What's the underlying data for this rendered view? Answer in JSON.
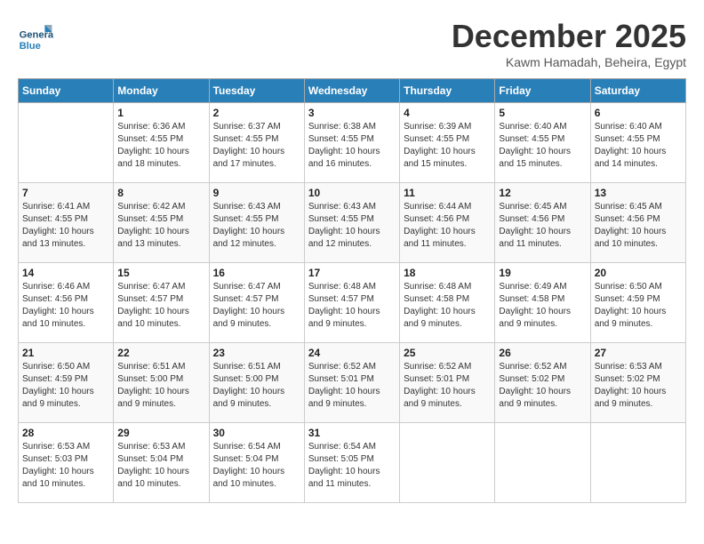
{
  "header": {
    "logo_general": "General",
    "logo_blue": "Blue",
    "month_title": "December 2025",
    "location": "Kawm Hamadah, Beheira, Egypt"
  },
  "days_of_week": [
    "Sunday",
    "Monday",
    "Tuesday",
    "Wednesday",
    "Thursday",
    "Friday",
    "Saturday"
  ],
  "weeks": [
    [
      {
        "day": "",
        "sunrise": "",
        "sunset": "",
        "daylight": ""
      },
      {
        "day": "1",
        "sunrise": "Sunrise: 6:36 AM",
        "sunset": "Sunset: 4:55 PM",
        "daylight": "Daylight: 10 hours and 18 minutes."
      },
      {
        "day": "2",
        "sunrise": "Sunrise: 6:37 AM",
        "sunset": "Sunset: 4:55 PM",
        "daylight": "Daylight: 10 hours and 17 minutes."
      },
      {
        "day": "3",
        "sunrise": "Sunrise: 6:38 AM",
        "sunset": "Sunset: 4:55 PM",
        "daylight": "Daylight: 10 hours and 16 minutes."
      },
      {
        "day": "4",
        "sunrise": "Sunrise: 6:39 AM",
        "sunset": "Sunset: 4:55 PM",
        "daylight": "Daylight: 10 hours and 15 minutes."
      },
      {
        "day": "5",
        "sunrise": "Sunrise: 6:40 AM",
        "sunset": "Sunset: 4:55 PM",
        "daylight": "Daylight: 10 hours and 15 minutes."
      },
      {
        "day": "6",
        "sunrise": "Sunrise: 6:40 AM",
        "sunset": "Sunset: 4:55 PM",
        "daylight": "Daylight: 10 hours and 14 minutes."
      }
    ],
    [
      {
        "day": "7",
        "sunrise": "Sunrise: 6:41 AM",
        "sunset": "Sunset: 4:55 PM",
        "daylight": "Daylight: 10 hours and 13 minutes."
      },
      {
        "day": "8",
        "sunrise": "Sunrise: 6:42 AM",
        "sunset": "Sunset: 4:55 PM",
        "daylight": "Daylight: 10 hours and 13 minutes."
      },
      {
        "day": "9",
        "sunrise": "Sunrise: 6:43 AM",
        "sunset": "Sunset: 4:55 PM",
        "daylight": "Daylight: 10 hours and 12 minutes."
      },
      {
        "day": "10",
        "sunrise": "Sunrise: 6:43 AM",
        "sunset": "Sunset: 4:55 PM",
        "daylight": "Daylight: 10 hours and 12 minutes."
      },
      {
        "day": "11",
        "sunrise": "Sunrise: 6:44 AM",
        "sunset": "Sunset: 4:56 PM",
        "daylight": "Daylight: 10 hours and 11 minutes."
      },
      {
        "day": "12",
        "sunrise": "Sunrise: 6:45 AM",
        "sunset": "Sunset: 4:56 PM",
        "daylight": "Daylight: 10 hours and 11 minutes."
      },
      {
        "day": "13",
        "sunrise": "Sunrise: 6:45 AM",
        "sunset": "Sunset: 4:56 PM",
        "daylight": "Daylight: 10 hours and 10 minutes."
      }
    ],
    [
      {
        "day": "14",
        "sunrise": "Sunrise: 6:46 AM",
        "sunset": "Sunset: 4:56 PM",
        "daylight": "Daylight: 10 hours and 10 minutes."
      },
      {
        "day": "15",
        "sunrise": "Sunrise: 6:47 AM",
        "sunset": "Sunset: 4:57 PM",
        "daylight": "Daylight: 10 hours and 10 minutes."
      },
      {
        "day": "16",
        "sunrise": "Sunrise: 6:47 AM",
        "sunset": "Sunset: 4:57 PM",
        "daylight": "Daylight: 10 hours and 9 minutes."
      },
      {
        "day": "17",
        "sunrise": "Sunrise: 6:48 AM",
        "sunset": "Sunset: 4:57 PM",
        "daylight": "Daylight: 10 hours and 9 minutes."
      },
      {
        "day": "18",
        "sunrise": "Sunrise: 6:48 AM",
        "sunset": "Sunset: 4:58 PM",
        "daylight": "Daylight: 10 hours and 9 minutes."
      },
      {
        "day": "19",
        "sunrise": "Sunrise: 6:49 AM",
        "sunset": "Sunset: 4:58 PM",
        "daylight": "Daylight: 10 hours and 9 minutes."
      },
      {
        "day": "20",
        "sunrise": "Sunrise: 6:50 AM",
        "sunset": "Sunset: 4:59 PM",
        "daylight": "Daylight: 10 hours and 9 minutes."
      }
    ],
    [
      {
        "day": "21",
        "sunrise": "Sunrise: 6:50 AM",
        "sunset": "Sunset: 4:59 PM",
        "daylight": "Daylight: 10 hours and 9 minutes."
      },
      {
        "day": "22",
        "sunrise": "Sunrise: 6:51 AM",
        "sunset": "Sunset: 5:00 PM",
        "daylight": "Daylight: 10 hours and 9 minutes."
      },
      {
        "day": "23",
        "sunrise": "Sunrise: 6:51 AM",
        "sunset": "Sunset: 5:00 PM",
        "daylight": "Daylight: 10 hours and 9 minutes."
      },
      {
        "day": "24",
        "sunrise": "Sunrise: 6:52 AM",
        "sunset": "Sunset: 5:01 PM",
        "daylight": "Daylight: 10 hours and 9 minutes."
      },
      {
        "day": "25",
        "sunrise": "Sunrise: 6:52 AM",
        "sunset": "Sunset: 5:01 PM",
        "daylight": "Daylight: 10 hours and 9 minutes."
      },
      {
        "day": "26",
        "sunrise": "Sunrise: 6:52 AM",
        "sunset": "Sunset: 5:02 PM",
        "daylight": "Daylight: 10 hours and 9 minutes."
      },
      {
        "day": "27",
        "sunrise": "Sunrise: 6:53 AM",
        "sunset": "Sunset: 5:02 PM",
        "daylight": "Daylight: 10 hours and 9 minutes."
      }
    ],
    [
      {
        "day": "28",
        "sunrise": "Sunrise: 6:53 AM",
        "sunset": "Sunset: 5:03 PM",
        "daylight": "Daylight: 10 hours and 10 minutes."
      },
      {
        "day": "29",
        "sunrise": "Sunrise: 6:53 AM",
        "sunset": "Sunset: 5:04 PM",
        "daylight": "Daylight: 10 hours and 10 minutes."
      },
      {
        "day": "30",
        "sunrise": "Sunrise: 6:54 AM",
        "sunset": "Sunset: 5:04 PM",
        "daylight": "Daylight: 10 hours and 10 minutes."
      },
      {
        "day": "31",
        "sunrise": "Sunrise: 6:54 AM",
        "sunset": "Sunset: 5:05 PM",
        "daylight": "Daylight: 10 hours and 11 minutes."
      },
      {
        "day": "",
        "sunrise": "",
        "sunset": "",
        "daylight": ""
      },
      {
        "day": "",
        "sunrise": "",
        "sunset": "",
        "daylight": ""
      },
      {
        "day": "",
        "sunrise": "",
        "sunset": "",
        "daylight": ""
      }
    ]
  ]
}
